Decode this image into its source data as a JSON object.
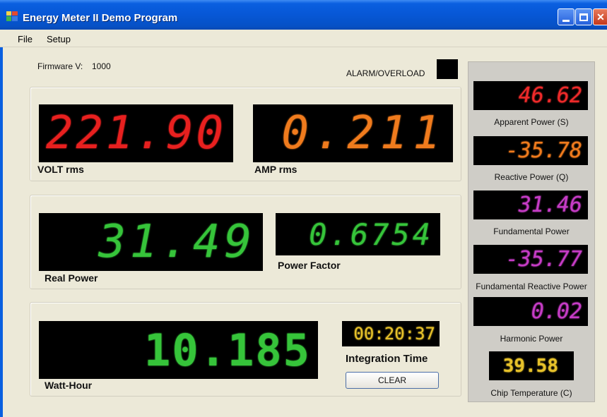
{
  "window": {
    "title": "Energy Meter II Demo Program"
  },
  "menu": {
    "file": "File",
    "setup": "Setup"
  },
  "firmware": {
    "label": "Firmware V:",
    "value": "1000"
  },
  "alarm": {
    "label": "ALARM/OVERLOAD",
    "color": "#000000"
  },
  "voltage": {
    "value": "221.90",
    "label": "VOLT rms",
    "color": "#e8201f"
  },
  "current": {
    "value": "0.211",
    "label": "AMP rms",
    "color": "#f07b1d"
  },
  "real_power": {
    "value": "31.49",
    "label": "Real Power",
    "color": "#36c43a"
  },
  "power_factor": {
    "value": "0.6754",
    "label": "Power Factor",
    "color": "#36c43a"
  },
  "watt_hour": {
    "value": "10.185",
    "label": "Watt-Hour",
    "color": "#36c43a"
  },
  "integration": {
    "value": "00:20:37",
    "label": "Integration Time",
    "color": "#e6c12a"
  },
  "clear_button": "CLEAR",
  "side": {
    "apparent_power": {
      "value": "46.62",
      "label": "Apparent Power (S)",
      "color": "#ee2a2a"
    },
    "reactive_power": {
      "value": "-35.78",
      "label": "Reactive Power (Q)",
      "color": "#f07b1d"
    },
    "fundamental_power": {
      "value": "31.46",
      "label": "Fundamental Power",
      "color": "#c63cc6"
    },
    "fundamental_reactive_power": {
      "value": "-35.77",
      "label": "Fundamental Reactive Power",
      "color": "#c63cc6"
    },
    "harmonic_power": {
      "value": "0.02",
      "label": "Harmonic Power",
      "color": "#c63cc6"
    },
    "chip_temperature": {
      "value": "39.58",
      "label": "Chip Temperature (C)",
      "color": "#e6c12a"
    }
  }
}
